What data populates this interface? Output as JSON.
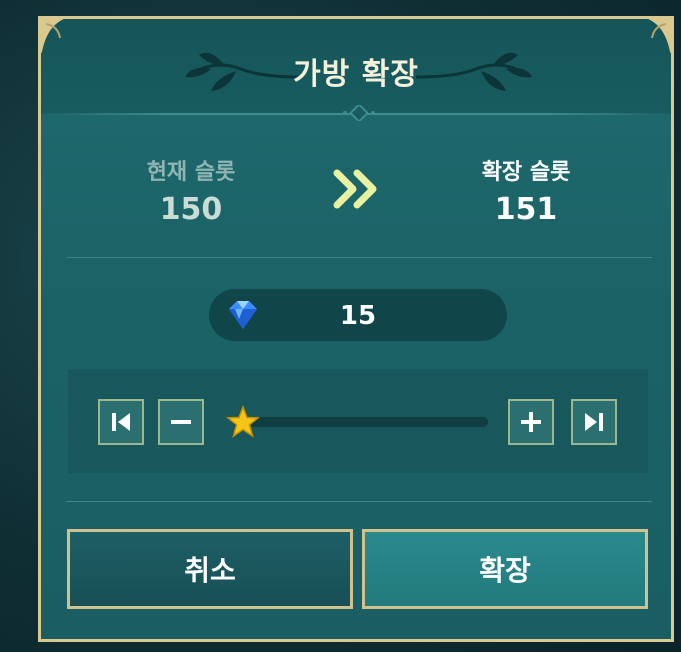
{
  "dialog": {
    "title": "가방 확장",
    "current_slot": {
      "label": "현재 슬롯",
      "value": "150"
    },
    "expanded_slot": {
      "label": "확장 슬롯",
      "value": "151"
    },
    "cost": {
      "currency_icon": "diamond-gem-icon",
      "value": "15"
    },
    "slider": {
      "level_fraction": 0.0,
      "first_icon": "skip-to-start-icon",
      "minus_icon": "minus-icon",
      "plus_icon": "plus-icon",
      "last_icon": "skip-to-end-icon",
      "thumb_icon": "star-icon"
    },
    "buttons": {
      "cancel_label": "취소",
      "confirm_label": "확장"
    }
  },
  "colors": {
    "panel": "#1d6569",
    "border_gold": "#d9c98f",
    "star": "#f5c518",
    "arrows": "#e8f2a0"
  }
}
